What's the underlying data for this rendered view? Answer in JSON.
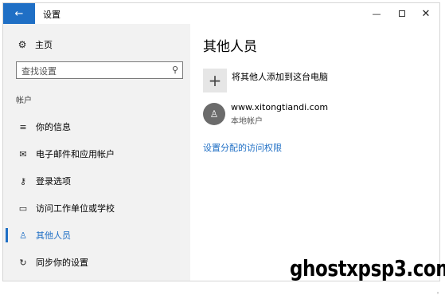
{
  "window": {
    "back_icon": "arrow-left-icon",
    "title": "设置",
    "min_glyph": "—",
    "close_glyph": "✕"
  },
  "sidebar": {
    "home_label": "主页",
    "search_placeholder": "查找设置",
    "section_label": "帐户",
    "items": [
      {
        "label": "你的信息",
        "icon": "person-card-icon",
        "active": false
      },
      {
        "label": "电子邮件和应用帐户",
        "icon": "mail-icon",
        "active": false
      },
      {
        "label": "登录选项",
        "icon": "key-icon",
        "active": false
      },
      {
        "label": "访问工作单位或学校",
        "icon": "briefcase-icon",
        "active": false
      },
      {
        "label": "其他人员",
        "icon": "person-icon",
        "active": true
      },
      {
        "label": "同步你的设置",
        "icon": "sync-icon",
        "active": false
      }
    ]
  },
  "main": {
    "title": "其他人员",
    "add_label": "将其他人添加到这台电脑",
    "user": {
      "name": "www.xitongtiandi.com",
      "type": "本地帐户"
    },
    "access_link": "设置分配的访问权限"
  },
  "watermark": "ghostxpsp3.com",
  "colors": {
    "accent": "#1f6fc5",
    "sidebar_bg": "#f2f2f2",
    "avatar_bg": "#6b6b6b"
  }
}
